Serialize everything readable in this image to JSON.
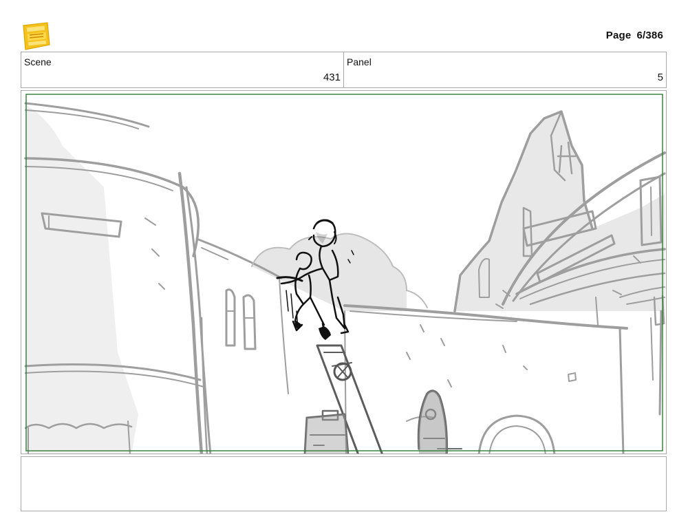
{
  "header": {
    "logo_icon": "young-jedi-adventures-logo",
    "page_label": "Page",
    "page_value": "6/386"
  },
  "info": {
    "scene_label": "Scene",
    "scene_value": "431",
    "panel_label": "Panel",
    "panel_value": "5"
  },
  "panel": {
    "safe_frame_color": "#2e7d32"
  },
  "notes": {
    "text": ""
  }
}
